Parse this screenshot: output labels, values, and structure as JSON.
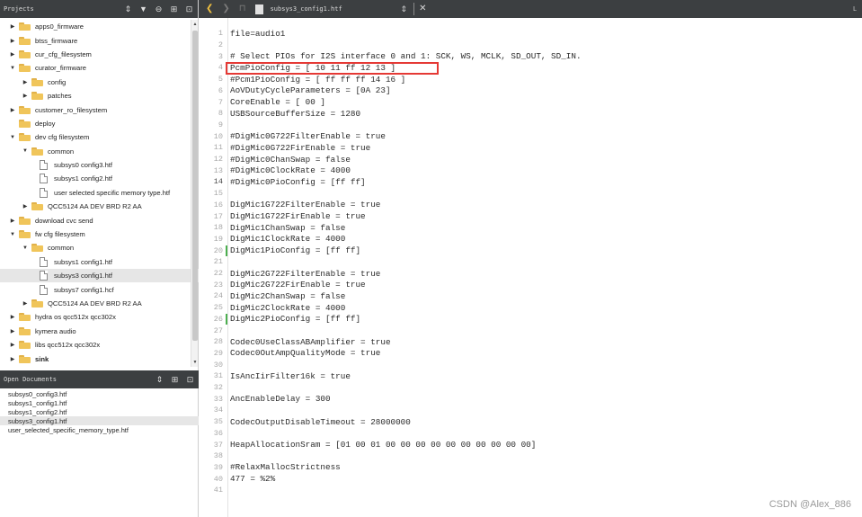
{
  "projects": {
    "title": "Projects",
    "tree": [
      {
        "label": "apps0_firmware",
        "depth": 0,
        "state": "collapsed",
        "kind": "folder"
      },
      {
        "label": "btss_firmware",
        "depth": 0,
        "state": "collapsed",
        "kind": "folder"
      },
      {
        "label": "cur_cfg_filesystem",
        "depth": 0,
        "state": "collapsed",
        "kind": "folder"
      },
      {
        "label": "curator_firmware",
        "depth": 0,
        "state": "expanded",
        "kind": "folder"
      },
      {
        "label": "config",
        "depth": 1,
        "state": "collapsed",
        "kind": "folder"
      },
      {
        "label": "patches",
        "depth": 1,
        "state": "collapsed",
        "kind": "folder"
      },
      {
        "label": "customer_ro_filesystem",
        "depth": 0,
        "state": "collapsed",
        "kind": "folder"
      },
      {
        "label": "deploy",
        "depth": 0,
        "state": "none",
        "kind": "folder"
      },
      {
        "label": "dev cfg filesystem",
        "depth": 0,
        "state": "expanded",
        "kind": "folder"
      },
      {
        "label": "common",
        "depth": 1,
        "state": "expanded",
        "kind": "folder"
      },
      {
        "label": "subsys0 config3.htf",
        "depth": 2,
        "state": "none",
        "kind": "file"
      },
      {
        "label": "subsys1 config2.htf",
        "depth": 2,
        "state": "none",
        "kind": "file"
      },
      {
        "label": "user selected specific memory type.htf",
        "depth": 2,
        "state": "none",
        "kind": "file"
      },
      {
        "label": "QCC5124 AA DEV BRD R2 AA",
        "depth": 1,
        "state": "collapsed",
        "kind": "folder"
      },
      {
        "label": "download cvc send",
        "depth": 0,
        "state": "collapsed",
        "kind": "folder"
      },
      {
        "label": "fw cfg filesystem",
        "depth": 0,
        "state": "expanded",
        "kind": "folder"
      },
      {
        "label": "common",
        "depth": 1,
        "state": "expanded",
        "kind": "folder"
      },
      {
        "label": "subsys1 config1.htf",
        "depth": 2,
        "state": "none",
        "kind": "file"
      },
      {
        "label": "subsys3 config1.htf",
        "depth": 2,
        "state": "none",
        "kind": "file",
        "selected": true
      },
      {
        "label": "subsys7 config1.hcf",
        "depth": 2,
        "state": "none",
        "kind": "file"
      },
      {
        "label": "QCC5124 AA DEV BRD R2 AA",
        "depth": 1,
        "state": "collapsed",
        "kind": "folder"
      },
      {
        "label": "hydra os qcc512x qcc302x",
        "depth": 0,
        "state": "collapsed",
        "kind": "folder"
      },
      {
        "label": "kymera audio",
        "depth": 0,
        "state": "collapsed",
        "kind": "folder"
      },
      {
        "label": "libs qcc512x qcc302x",
        "depth": 0,
        "state": "collapsed",
        "kind": "folder"
      },
      {
        "label": "sink",
        "depth": 0,
        "state": "collapsed",
        "kind": "folder",
        "bold": true
      }
    ]
  },
  "open_documents": {
    "title": "Open Documents",
    "items": [
      {
        "label": "subsys0_config3.htf"
      },
      {
        "label": "subsys1_config1.htf"
      },
      {
        "label": "subsys1_config2.htf"
      },
      {
        "label": "subsys3_config1.htf",
        "selected": true
      },
      {
        "label": "user_selected_specific_memory_type.htf"
      }
    ]
  },
  "toolbar": {
    "tab_name": "subsys3_config1.htf",
    "right_text": "L"
  },
  "editor": {
    "lines": [
      {
        "n": "1",
        "text": "file=audio1"
      },
      {
        "n": "2",
        "text": ""
      },
      {
        "n": "3",
        "text": "# Select PIOs for I2S interface 0 and 1: SCK, WS, MCLK, SD_OUT, SD_IN."
      },
      {
        "n": "4",
        "text": "PcmPioConfig = [ 10 11 ff 12 13 ]"
      },
      {
        "n": "5",
        "text": "#Pcm1PioConfig = [ ff ff ff 14 16 ]"
      },
      {
        "n": "6",
        "text": "AoVDutyCycleParameters = [0A 23]"
      },
      {
        "n": "7",
        "text": "CoreEnable = [ 00 ]"
      },
      {
        "n": "8",
        "text": "USBSourceBufferSize = 1280"
      },
      {
        "n": "9",
        "text": ""
      },
      {
        "n": "10",
        "text": "#DigMic0G722FilterEnable = true"
      },
      {
        "n": "11",
        "text": "#DigMic0G722FirEnable = true"
      },
      {
        "n": "12",
        "text": "#DigMic0ChanSwap = false"
      },
      {
        "n": "13",
        "text": "#DigMic0ClockRate = 4000"
      },
      {
        "n": "14",
        "text": "#DigMic0PioConfig = [ff ff]",
        "bright": true
      },
      {
        "n": "15",
        "text": ""
      },
      {
        "n": "16",
        "text": "DigMic1G722FilterEnable = true"
      },
      {
        "n": "17",
        "text": "DigMic1G722FirEnable = true"
      },
      {
        "n": "18",
        "text": "DigMic1ChanSwap = false"
      },
      {
        "n": "19",
        "text": "DigMic1ClockRate = 4000"
      },
      {
        "n": "20",
        "text": "DigMic1PioConfig = [ff ff]",
        "mark": true
      },
      {
        "n": "21",
        "text": ""
      },
      {
        "n": "22",
        "text": "DigMic2G722FilterEnable = true"
      },
      {
        "n": "23",
        "text": "DigMic2G722FirEnable = true"
      },
      {
        "n": "24",
        "text": "DigMic2ChanSwap = false"
      },
      {
        "n": "25",
        "text": "DigMic2ClockRate = 4000"
      },
      {
        "n": "26",
        "text": "DigMic2PioConfig = [ff ff]",
        "mark": true
      },
      {
        "n": "27",
        "text": ""
      },
      {
        "n": "28",
        "text": "Codec0UseClassABAmplifier = true"
      },
      {
        "n": "29",
        "text": "Codec0OutAmpQualityMode = true"
      },
      {
        "n": "30",
        "text": ""
      },
      {
        "n": "31",
        "text": "IsAncIirFilter16k = true"
      },
      {
        "n": "32",
        "text": ""
      },
      {
        "n": "33",
        "text": "AncEnableDelay = 300"
      },
      {
        "n": "34",
        "text": ""
      },
      {
        "n": "35",
        "text": "CodecOutputDisableTimeout = 28000000"
      },
      {
        "n": "36",
        "text": ""
      },
      {
        "n": "37",
        "text": "HeapAllocationSram = [01 00 01 00 00 00 00 00 00 00 00 00 00]"
      },
      {
        "n": "38",
        "text": ""
      },
      {
        "n": "39",
        "text": "#RelaxMallocStrictness"
      },
      {
        "n": "40",
        "text": "477 = %2%"
      },
      {
        "n": "41",
        "text": ""
      }
    ]
  },
  "watermark": "CSDN @Alex_886",
  "colors": {
    "header_bg": "#3c3f41",
    "highlight_box": "#e53935",
    "change_mark": "#4caf50",
    "folder": "#f0c55a"
  }
}
